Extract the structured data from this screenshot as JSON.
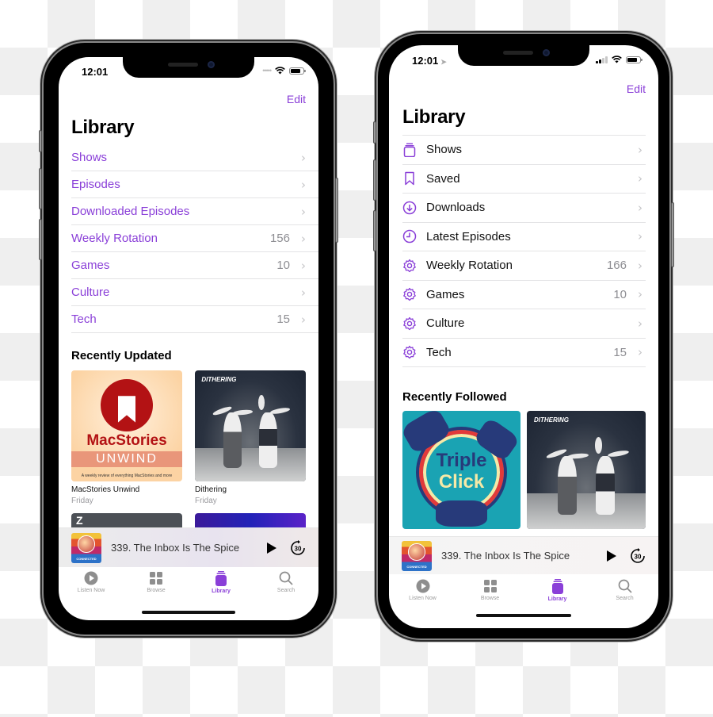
{
  "accent_color": "#8a3fd8",
  "phones": [
    {
      "status": {
        "time": "12:01"
      },
      "edit_label": "Edit",
      "title": "Library",
      "rows": [
        {
          "label": "Shows",
          "count": ""
        },
        {
          "label": "Episodes",
          "count": ""
        },
        {
          "label": "Downloaded Episodes",
          "count": ""
        },
        {
          "label": "Weekly Rotation",
          "count": "156"
        },
        {
          "label": "Games",
          "count": "10"
        },
        {
          "label": "Culture",
          "count": ""
        },
        {
          "label": "Tech",
          "count": "15"
        }
      ],
      "section_title": "Recently Updated",
      "shows": [
        {
          "name": "MacStories Unwind",
          "date": "Friday",
          "art_title": "MacStories",
          "art_band": "UNWIND",
          "art_tagline": "A weekly review of everything MacStories and more"
        },
        {
          "name": "Dithering",
          "date": "Friday",
          "art_title": "DITHERING"
        }
      ],
      "now_playing": {
        "title": "339. The Inbox Is The Spice",
        "art_label": "CONNECTED",
        "skip_label": "30"
      },
      "tabs": [
        {
          "label": "Listen Now",
          "icon": "play-circle-icon"
        },
        {
          "label": "Browse",
          "icon": "grid-icon"
        },
        {
          "label": "Library",
          "icon": "library-icon",
          "active": true
        },
        {
          "label": "Search",
          "icon": "search-icon"
        }
      ]
    },
    {
      "status": {
        "time": "12:01"
      },
      "edit_label": "Edit",
      "title": "Library",
      "rows": [
        {
          "label": "Shows",
          "count": "",
          "icon": "shows-stack-icon"
        },
        {
          "label": "Saved",
          "count": "",
          "icon": "bookmark-icon"
        },
        {
          "label": "Downloads",
          "count": "",
          "icon": "download-circle-icon"
        },
        {
          "label": "Latest Episodes",
          "count": "",
          "icon": "clock-icon"
        },
        {
          "label": "Weekly Rotation",
          "count": "166",
          "icon": "gear-icon"
        },
        {
          "label": "Games",
          "count": "10",
          "icon": "gear-icon"
        },
        {
          "label": "Culture",
          "count": "",
          "icon": "gear-icon"
        },
        {
          "label": "Tech",
          "count": "15",
          "icon": "gear-icon"
        }
      ],
      "section_title": "Recently Followed",
      "shows": [
        {
          "name": "Triple Click",
          "art_title_1": "Triple",
          "art_title_2": "Click"
        },
        {
          "name": "Dithering",
          "art_title": "DITHERING"
        }
      ],
      "now_playing": {
        "title": "339. The Inbox Is The Spice",
        "art_label": "CONNECTED",
        "skip_label": "30"
      },
      "tabs": [
        {
          "label": "Listen Now",
          "icon": "play-circle-icon"
        },
        {
          "label": "Browse",
          "icon": "grid-icon"
        },
        {
          "label": "Library",
          "icon": "library-icon",
          "active": true
        },
        {
          "label": "Search",
          "icon": "search-icon"
        }
      ]
    }
  ]
}
